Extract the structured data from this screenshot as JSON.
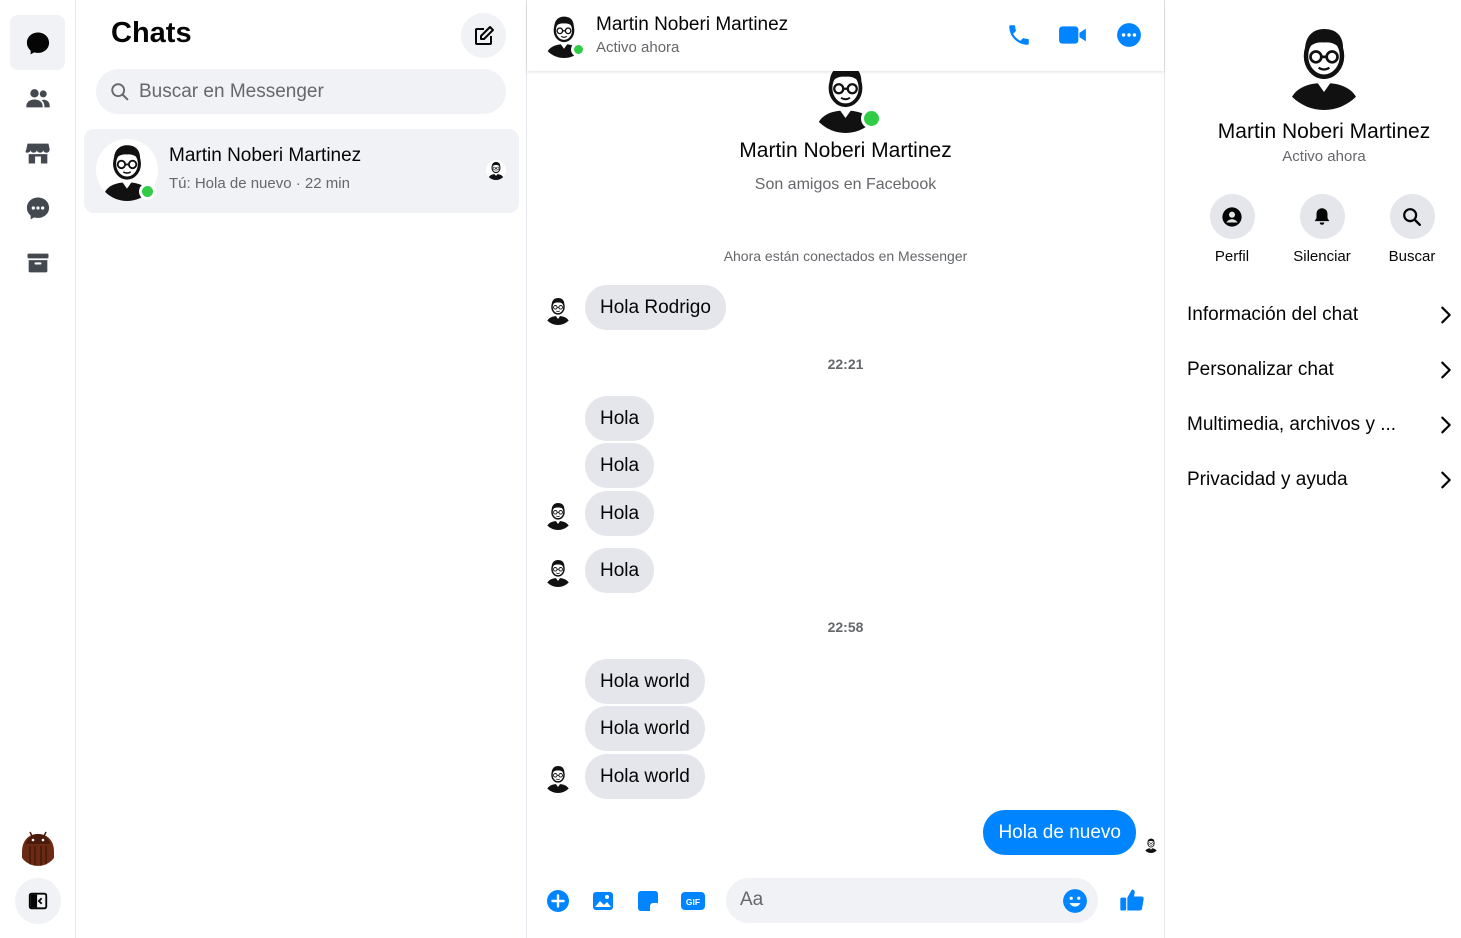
{
  "colors": {
    "accent": "#0084ff",
    "online": "#31cc46",
    "bubble_in": "#e4e6eb",
    "muted": "#65676b"
  },
  "rail": {
    "items": [
      {
        "icon": "chat-bubble-icon",
        "active": true
      },
      {
        "icon": "people-icon",
        "active": false
      },
      {
        "icon": "marketplace-icon",
        "active": false
      },
      {
        "icon": "message-requests-icon",
        "active": false
      },
      {
        "icon": "archive-icon",
        "active": false
      }
    ],
    "user_avatar_icon": "android-avatar-icon",
    "collapse_icon": "sidebar-toggle-icon"
  },
  "chatlist": {
    "title": "Chats",
    "compose_icon": "compose-icon",
    "search_placeholder": "Buscar en Messenger",
    "conversations": [
      {
        "name": "Martin Noberi Martinez",
        "preview": "Tú: Hola de nuevo",
        "time": "22 min",
        "separator": "·"
      }
    ]
  },
  "conversation": {
    "header": {
      "name": "Martin Noberi Martinez",
      "status": "Activo ahora"
    },
    "intro": {
      "name": "Martin Noberi Martinez",
      "subtitle": "Son amigos en Facebook"
    },
    "system_message": "Ahora están conectados en Messenger",
    "messages": [
      {
        "text": "Hola Rodrigo"
      },
      {
        "text": "Hola"
      },
      {
        "text": "Hola"
      },
      {
        "text": "Hola"
      },
      {
        "text": "Hola"
      },
      {
        "text": "Hola world"
      },
      {
        "text": "Hola world"
      },
      {
        "text": "Hola world"
      },
      {
        "text": "Hola de nuevo"
      }
    ],
    "timestamps": [
      "22:21",
      "22:58"
    ],
    "composer": {
      "placeholder": "Aa"
    }
  },
  "info": {
    "name": "Martin Noberi Martinez",
    "status": "Activo ahora",
    "actions": [
      {
        "label": "Perfil",
        "icon": "profile-icon"
      },
      {
        "label": "Silenciar",
        "icon": "bell-icon"
      },
      {
        "label": "Buscar",
        "icon": "search-icon"
      }
    ],
    "sections": [
      {
        "label": "Información del chat"
      },
      {
        "label": "Personalizar chat"
      },
      {
        "label": "Multimedia, archivos y ..."
      },
      {
        "label": "Privacidad y ayuda"
      }
    ]
  }
}
